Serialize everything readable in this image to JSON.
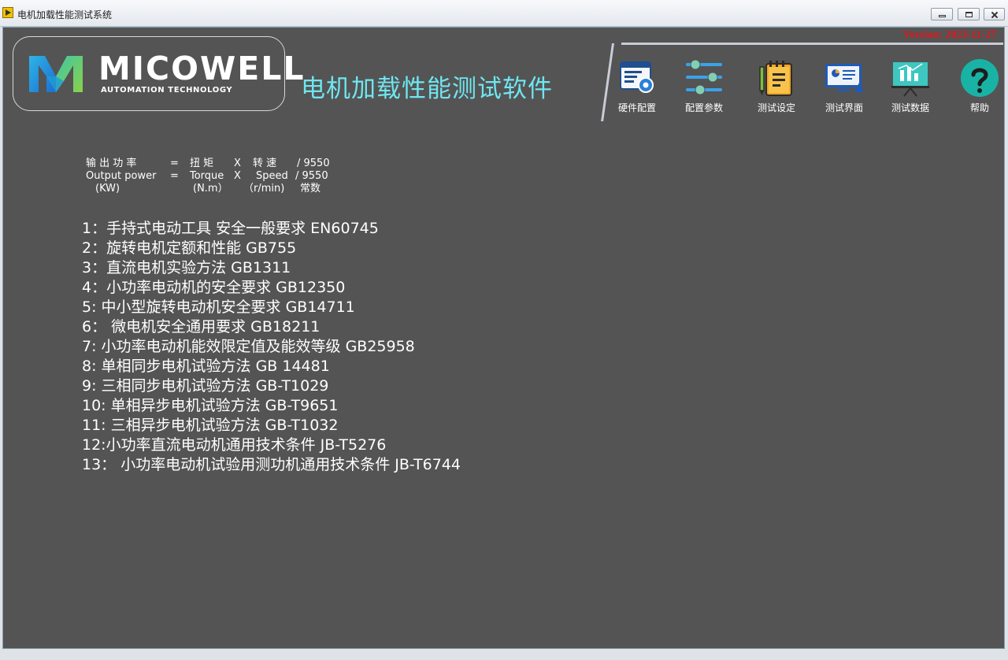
{
  "window": {
    "title": "电机加载性能测试系统"
  },
  "header": {
    "version": "Version: 2023-11-27",
    "logo_name": "MICOWELL",
    "logo_sub": "AUTOMATION TECHNOLOGY",
    "app_title": "电机加载性能测试软件"
  },
  "toolbar": {
    "items": [
      {
        "label": "硬件配置",
        "icon": "hardware-config-icon"
      },
      {
        "label": "配置参数",
        "icon": "sliders-icon"
      },
      {
        "label": "测试设定",
        "icon": "notepad-icon"
      },
      {
        "label": "测试界面",
        "icon": "monitor-icon"
      },
      {
        "label": "测试数据",
        "icon": "chart-board-icon"
      },
      {
        "label": "帮助",
        "icon": "help-icon"
      }
    ]
  },
  "formula": {
    "row1": {
      "a": "输 出 功 率",
      "eq": "=",
      "b": "扭  矩",
      "x": "X",
      "c": "转  速",
      "d": "/ 9550"
    },
    "row2": {
      "a": "Output power",
      "eq": "=",
      "b": "Torque",
      "x": "X",
      "c": "Speed",
      "d": "/ 9550"
    },
    "row3": {
      "a": "(KW)",
      "b": "(N.m）",
      "c": "（r/min)",
      "d": "常数"
    }
  },
  "standards": [
    "1：手持式电动工具 安全一般要求 EN60745",
    "2：旋转电机定额和性能 GB755",
    "3：直流电机实验方法 GB1311",
    "4：小功率电动机的安全要求 GB12350",
    "5:  中小型旋转电动机安全要求 GB14711",
    "6：  微电机安全通用要求 GB18211",
    "7:  小功率电动机能效限定值及能效等级 GB25958",
    "8:  单相同步电机试验方法 GB 14481",
    "9:  三相同步电机试验方法 GB-T1029",
    "10: 单相异步电机试验方法 GB-T9651",
    "11: 三相异步电机试验方法 GB-T1032",
    "12:小功率直流电动机通用技术条件 JB-T5276",
    "13： 小功率电动机试验用测功机通用技术条件 JB-T6744"
  ],
  "colors": {
    "panel_bg": "#545454",
    "title_accent": "#6fe6f0",
    "version_red": "#e0161a"
  }
}
